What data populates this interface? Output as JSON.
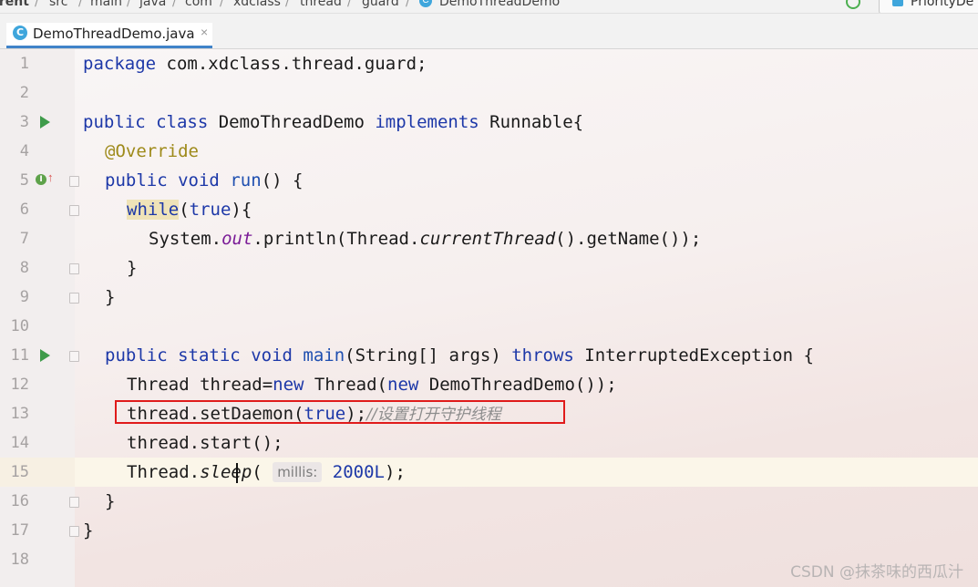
{
  "breadcrumb": {
    "items": [
      "rrent",
      "src",
      "main",
      "java",
      "com",
      "xdclass",
      "thread",
      "guard",
      "DemoThreadDemo"
    ],
    "right_button": "PriorityDe"
  },
  "tab": {
    "icon_letter": "C",
    "label": "DemoThreadDemo.java",
    "close": "×"
  },
  "editor": {
    "line_numbers": [
      "1",
      "2",
      "3",
      "4",
      "5",
      "6",
      "7",
      "8",
      "9",
      "10",
      "11",
      "12",
      "13",
      "14",
      "15",
      "16",
      "17",
      "18"
    ],
    "code": {
      "l1_kw": "package",
      "l1_rest": " com.xdclass.thread.guard;",
      "l3_kw1": "public",
      "l3_kw2": "class",
      "l3_name": " DemoThreadDemo ",
      "l3_kw3": "implements",
      "l3_rest": " Runnable{",
      "l4_ann": "@Override",
      "l5_kw1": "public",
      "l5_kw2": "void",
      "l5_fn": "run",
      "l5_rest": "() {",
      "l6_kw": "while",
      "l6_p1": "(",
      "l6_true": "true",
      "l6_p2": "){",
      "l7_a": "System.",
      "l7_field": "out",
      "l7_b": ".println(Thread.",
      "l7_italic": "currentThread",
      "l7_c": "().getName());",
      "l8": "}",
      "l9": "}",
      "l11_kw1": "public",
      "l11_kw2": "static",
      "l11_kw3": "void",
      "l11_fn": "main",
      "l11_mid": "(String[] args) ",
      "l11_kw4": "throws",
      "l11_rest": " InterruptedException {",
      "l12_a": "Thread thread=",
      "l12_kw1": "new",
      "l12_b": " Thread(",
      "l12_kw2": "new",
      "l12_c": " DemoThreadDemo());",
      "l13_a": "thread.setDaemon(",
      "l13_true": "true",
      "l13_b": ");",
      "l13_comment": "//设置打开守护线程",
      "l14": "thread.start();",
      "l15_a": "Thread.",
      "l15_italic": "sleep",
      "l15_p": "(",
      "l15_hint": "millis:",
      "l15_num": "2000L",
      "l15_b": ");",
      "l16": "}",
      "l17": "}"
    }
  },
  "watermark": "CSDN @抹茶味的西瓜汁",
  "colors": {
    "keyword": "#1d38a8",
    "annotation": "#9e8a1a",
    "highlight_box": "#e01b1b",
    "run_icon": "#3f9b4a"
  }
}
